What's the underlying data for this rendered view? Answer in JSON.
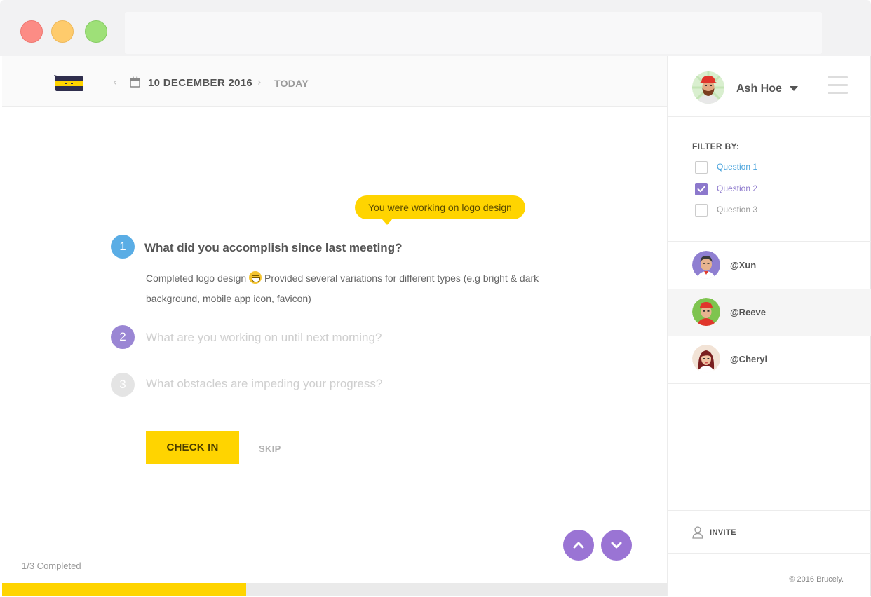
{
  "header": {
    "prev_arrow": "‹",
    "date": "10 DECEMBER 2016",
    "next_arrow": "›",
    "today_label": "TODAY"
  },
  "tooltip": "You were working on logo design",
  "questions": [
    {
      "number": "1",
      "text": "What did you accomplish since last meeting?",
      "state": "active",
      "color": "#5aade5"
    },
    {
      "number": "2",
      "text": "What are you working on until next morning?",
      "state": "pending",
      "color": "#9a86d4"
    },
    {
      "number": "3",
      "text": "What obstacles are impeding your progress?",
      "state": "pending",
      "color": "#e4e4e4"
    }
  ],
  "answer": {
    "before_emoji": "Completed logo design ",
    "emoji": "grinning-face",
    "after_emoji": " Provided several variations for different types (e.g bright & dark background, mobile app icon, favicon)"
  },
  "actions": {
    "checkin_label": "CHECK IN",
    "skip_label": "SKIP"
  },
  "progress": {
    "text": "1/3 Completed",
    "fraction": 0.3666
  },
  "user": {
    "name": "Ash Hoe"
  },
  "filter": {
    "title": "FILTER BY:",
    "items": [
      {
        "label": "Question 1",
        "checked": false,
        "color": "#49a3dc"
      },
      {
        "label": "Question 2",
        "checked": true,
        "color": "#8c78cc"
      },
      {
        "label": "Question 3",
        "checked": false,
        "color": "#999999"
      }
    ]
  },
  "members": [
    {
      "handle": "@Xun",
      "active": false
    },
    {
      "handle": "@Reeve",
      "active": true
    },
    {
      "handle": "@Cheryl",
      "active": false
    }
  ],
  "invite_label": "INVITE",
  "copyright": "© 2016 Brucely.",
  "colors": {
    "accent_yellow": "#ffd400",
    "accent_purple": "#9a74d4",
    "accent_blue": "#5aade5"
  }
}
